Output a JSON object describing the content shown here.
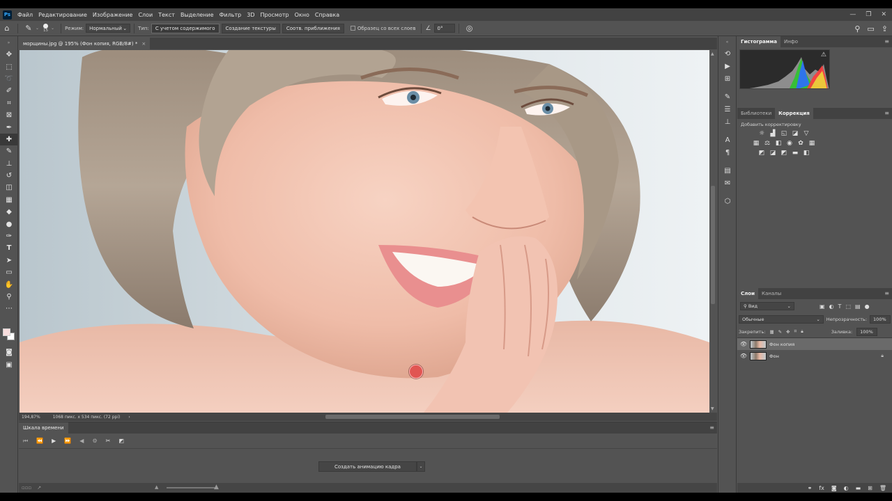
{
  "menu": {
    "logo": "Ps",
    "items": [
      "Файл",
      "Редактирование",
      "Изображение",
      "Слои",
      "Текст",
      "Выделение",
      "Фильтр",
      "3D",
      "Просмотр",
      "Окно",
      "Справка"
    ],
    "window_controls": [
      "—",
      "❐",
      "✕"
    ]
  },
  "options": {
    "brush_size": "15",
    "mode_label": "Режим:",
    "mode_value": "Нормальный",
    "type_label": "Тип:",
    "type_buttons": [
      "С учетом содержимого",
      "Создание текстуры",
      "Соотв. приближения"
    ],
    "sample_all_layers": "Образец со всех слоев",
    "angle": "0°"
  },
  "document": {
    "tab_title": "морщины.jpg @ 195% (Фон копия, RGB/8#) *",
    "close": "×"
  },
  "status": {
    "zoom": "194,87%",
    "size": "1068 пикс. x 534 пикс. (72 ppi)"
  },
  "timeline": {
    "tab": "Шкала времени",
    "create_button": "Создать анимацию кадра"
  },
  "panels": {
    "histogram_tabs": [
      "Гистограмма",
      "Инфо"
    ],
    "correction_tabs": [
      "Библиотеки",
      "Коррекция"
    ],
    "add_adjustment": "Добавить корректировку",
    "layers_tabs": [
      "Слои",
      "Каналы"
    ],
    "filter_kind": "Вид",
    "blend_mode": "Обычные",
    "opacity_label": "Непрозрачность:",
    "opacity_value": "100%",
    "lock_label": "Закрепить:",
    "fill_label": "Заливка:",
    "fill_value": "100%",
    "layers": [
      {
        "name": "Фон копия",
        "selected": true,
        "locked": false
      },
      {
        "name": "Фон",
        "selected": false,
        "locked": true
      }
    ]
  }
}
